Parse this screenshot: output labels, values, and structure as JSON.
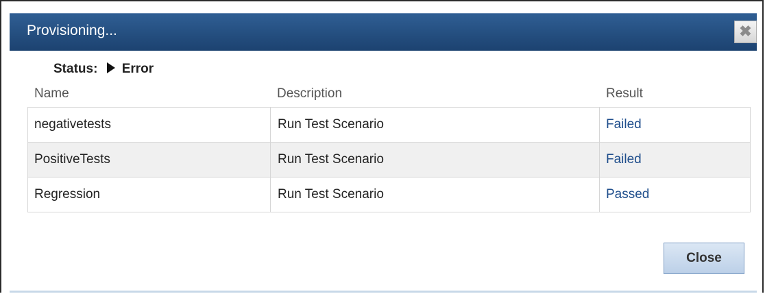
{
  "dialog": {
    "title": "Provisioning...",
    "close_icon": "✖"
  },
  "status": {
    "label": "Status:",
    "value": "Error"
  },
  "table": {
    "headers": [
      "Name",
      "Description",
      "Result"
    ],
    "rows": [
      {
        "name": "negativetests",
        "description": "Run Test Scenario",
        "result": "Failed"
      },
      {
        "name": "PositiveTests",
        "description": "Run Test Scenario",
        "result": "Failed"
      },
      {
        "name": "Regression",
        "description": "Run Test Scenario",
        "result": "Passed"
      }
    ]
  },
  "footer": {
    "close_label": "Close"
  },
  "colors": {
    "titlebar": "#1c4270",
    "result_link": "#1f4e8c"
  }
}
